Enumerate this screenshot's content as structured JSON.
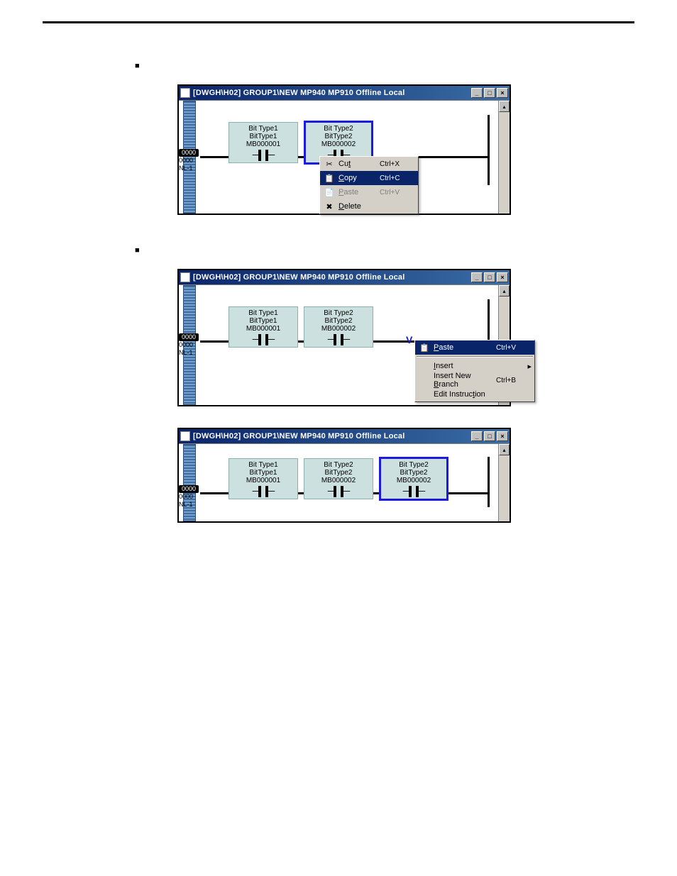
{
  "figures": {
    "fig1": {
      "title": "[DWGH\\H02]    GROUP1\\NEW  MP940  MP910      Offline  Local",
      "step_black": "0000",
      "step_lines": "0000\nNL-1",
      "contacts": [
        {
          "l1": "Bit Type1",
          "l2": "BitType1",
          "l3": "MB000001"
        },
        {
          "l1": "Bit Type2",
          "l2": "BitType2",
          "l3": "MB000002"
        }
      ],
      "menu": [
        {
          "icon": "✂",
          "label": "Cu",
          "u": "t",
          "shortcut": "Ctrl+X"
        },
        {
          "icon": "📋",
          "label": "",
          "u": "C",
          "label2": "opy",
          "shortcut": "Ctrl+C"
        },
        {
          "icon": "📄",
          "label": "",
          "u": "P",
          "label2": "aste",
          "shortcut": "Ctrl+V"
        },
        {
          "icon": "✖",
          "label": "",
          "u": "D",
          "label2": "elete",
          "shortcut": ""
        }
      ]
    },
    "fig2": {
      "title": "[DWGH\\H02]    GROUP1\\NEW  MP940  MP910      Offline  Local",
      "step_black": "0000",
      "step_lines": "0000\nNL-1",
      "contacts": [
        {
          "l1": "Bit Type1",
          "l2": "BitType1",
          "l3": "MB000001"
        },
        {
          "l1": "Bit Type2",
          "l2": "BitType2",
          "l3": "MB000002"
        }
      ],
      "paste_marker": "V",
      "menu": [
        {
          "icon": "📋",
          "u": "P",
          "label2": "aste",
          "shortcut": "Ctrl+V"
        },
        {
          "u": "I",
          "label2": "nsert"
        },
        {
          "label_pre": "Insert New ",
          "u": "B",
          "label2": "ranch",
          "shortcut": "Ctrl+B"
        },
        {
          "label_pre": "Edit Instruc",
          "u": "t",
          "label2": "ion",
          "shortcut": ""
        }
      ]
    },
    "fig3": {
      "title": "[DWGH\\H02]    GROUP1\\NEW  MP940  MP910      Offline  Local",
      "step_black": "0000",
      "step_lines": "0000\nNL-1",
      "contacts": [
        {
          "l1": "Bit Type1",
          "l2": "BitType1",
          "l3": "MB000001"
        },
        {
          "l1": "Bit Type2",
          "l2": "BitType2",
          "l3": "MB000002"
        },
        {
          "l1": "Bit Type2",
          "l2": "BitType2",
          "l3": "MB000002"
        }
      ]
    }
  }
}
